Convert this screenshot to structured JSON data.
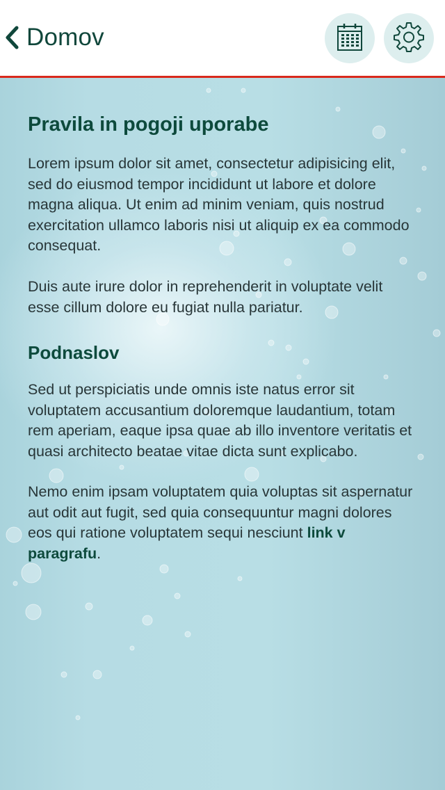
{
  "header": {
    "back_label": "Domov",
    "calendar_icon": "calendar-icon",
    "settings_icon": "gear-icon"
  },
  "colors": {
    "header_border": "#d9291c",
    "heading": "#0d4a3c",
    "body_text": "#283638",
    "icon_circle": "#ddeeee",
    "background": "#b3dbe3"
  },
  "article": {
    "title": "Pravila in pogoji uporabe",
    "paragraph_1": "Lorem ipsum dolor sit amet, consectetur adipisicing elit, sed do eiusmod tempor incididunt ut labore et dolore magna aliqua. Ut enim ad minim veniam, quis nostrud exercitation ullamco laboris nisi ut aliquip ex ea commodo consequat.",
    "paragraph_2": "Duis aute irure dolor in reprehenderit in voluptate velit esse cillum dolore eu fugiat nulla pariatur.",
    "subtitle": "Podnaslov",
    "paragraph_3": "Sed ut perspiciatis unde omnis iste natus error sit voluptatem accusantium doloremque laudantium, totam rem aperiam, eaque ipsa quae ab illo inventore veritatis et quasi architecto beatae vitae dicta sunt explicabo.",
    "paragraph_4_text": "Nemo enim ipsam voluptatem quia voluptas sit aspernatur aut odit aut fugit, sed quia consequuntur magni dolores eos qui ratione voluptatem sequi nesciunt ",
    "paragraph_4_link": "link v paragrafu",
    "paragraph_4_end": "."
  }
}
